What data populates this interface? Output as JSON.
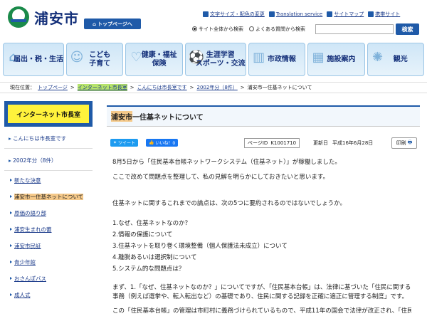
{
  "header": {
    "site_name": "浦安市",
    "top_page_button": "トップページへ",
    "util_links": [
      "文字サイズ・配色の変更",
      "Translation service",
      "サイトマップ",
      "携帯サイト"
    ],
    "search_scope": [
      "サイト全体から検索",
      "よくある質問から検索"
    ],
    "search_button": "検索"
  },
  "nav": [
    {
      "label": "届出・税・生活",
      "icon": "house-icon"
    },
    {
      "label": "こども\n子育て",
      "icon": "child-icon"
    },
    {
      "label": "健康・福祉\n保険",
      "icon": "health-icon"
    },
    {
      "label": "生涯学習\nスポーツ・交流",
      "icon": "sports-icon"
    },
    {
      "label": "市政情報",
      "icon": "building-icon"
    },
    {
      "label": "施設案内",
      "icon": "facility-icon"
    },
    {
      "label": "観光",
      "icon": "ferris-wheel-icon"
    }
  ],
  "breadcrumb": {
    "prefix": "現在位置：",
    "items": [
      "トップページ",
      "インターネット市長室",
      "こんにちは市長室です",
      "2002年分（8件）"
    ],
    "current": "浦安市一住基ネットについて"
  },
  "sidebar": {
    "title": "インターネット市長室",
    "items": [
      {
        "label": "こんにちは市長室です",
        "level": 1
      },
      {
        "label": "2002年分（8件）",
        "level": 1
      },
      {
        "label": "新たな決意",
        "level": 2
      },
      {
        "label": "浦安市一住基ネットについて",
        "level": 2
      },
      {
        "label": "原価の語り部",
        "level": 2
      },
      {
        "label": "浦安生まれの蕾",
        "level": 2
      },
      {
        "label": "浦安市民証",
        "level": 2
      },
      {
        "label": "青少年館",
        "level": 2
      },
      {
        "label": "おさんぽバス",
        "level": 2
      },
      {
        "label": "成人式",
        "level": 2
      }
    ]
  },
  "main": {
    "title_hl": "浦安市",
    "title_rest": "一住基ネットについて",
    "tweet": "ツイート",
    "like": "いいね！0",
    "page_id_label": "ページID",
    "page_id": "K1001710",
    "updated_label": "更新日",
    "updated_date": "平成16年6月28日",
    "print": "印刷",
    "paragraphs": [
      "8月5日から「住民基本台帳ネットワークシステム（住基ネット）」が稼働しました。",
      "ここで改めて問題点を整理して、私の見解を明らかにしておきたいと思います。",
      "住基ネットに関するこれまでの論点は、次の5つに要約されるのではないでしょうか。",
      "1.なぜ、住基ネットなのか？\n2.情報の保護について\n3.住基ネットを取り巻く環境整備（個人保護法未成立）について\n4.離脱あるいは選択制について\n5.システム的な問題点は？",
      "まず、1.「なぜ、住基ネットなのか？」についてですが、「住民基本台帳」は、法律に基づいた「住民に関する事務（例えば選挙や、転入転出など）の基礎であり、住民に関する記録を正確に適正に管理する制度」です。",
      "この「住民基本台帳」の管理は市町村に義務づけられているもので、平成11年の国会で法律が改正され、「住民"
    ]
  }
}
